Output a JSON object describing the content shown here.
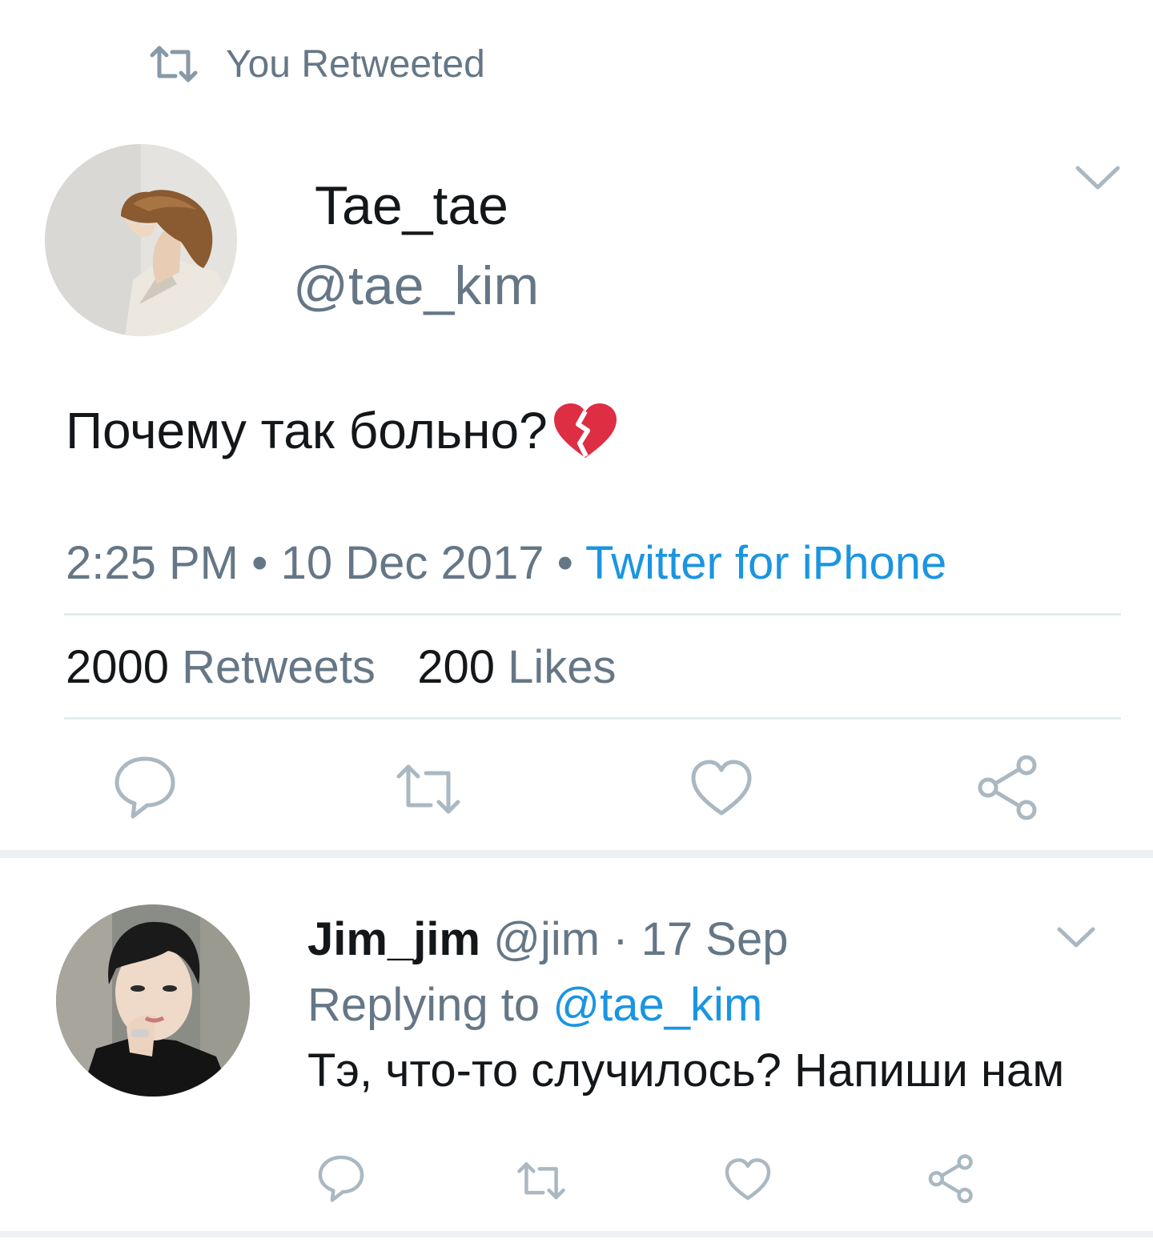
{
  "retweet_context": {
    "label": "You Retweeted"
  },
  "main_tweet": {
    "display_name": "Tae_tae",
    "handle": "@tae_kim",
    "text": "Почему так больно?",
    "emoji_icon": "broken-heart-icon",
    "time": "2:25 PM",
    "date": "10 Dec 2017",
    "separator": "•",
    "source": "Twitter for iPhone",
    "stats": {
      "retweets_count": "2000",
      "retweets_label": "Retweets",
      "likes_count": "200",
      "likes_label": "Likes"
    },
    "actions": [
      "reply-icon",
      "retweet-icon",
      "like-icon",
      "share-icon"
    ]
  },
  "reply_tweet": {
    "display_name": "Jim_jim",
    "handle": "@jim",
    "separator": "·",
    "date": "17 Sep",
    "replying_prefix": "Replying to",
    "replying_to": "@tae_kim",
    "text": "Тэ, что-то случилось? Напиши нам",
    "actions": [
      "reply-icon",
      "retweet-icon",
      "like-icon",
      "share-icon"
    ]
  },
  "colors": {
    "text_primary": "#14171a",
    "text_secondary": "#657786",
    "link": "#1b95e0",
    "divider": "#e6ecf0",
    "icon": "#8899a6",
    "broken_heart": "#e0245e"
  }
}
